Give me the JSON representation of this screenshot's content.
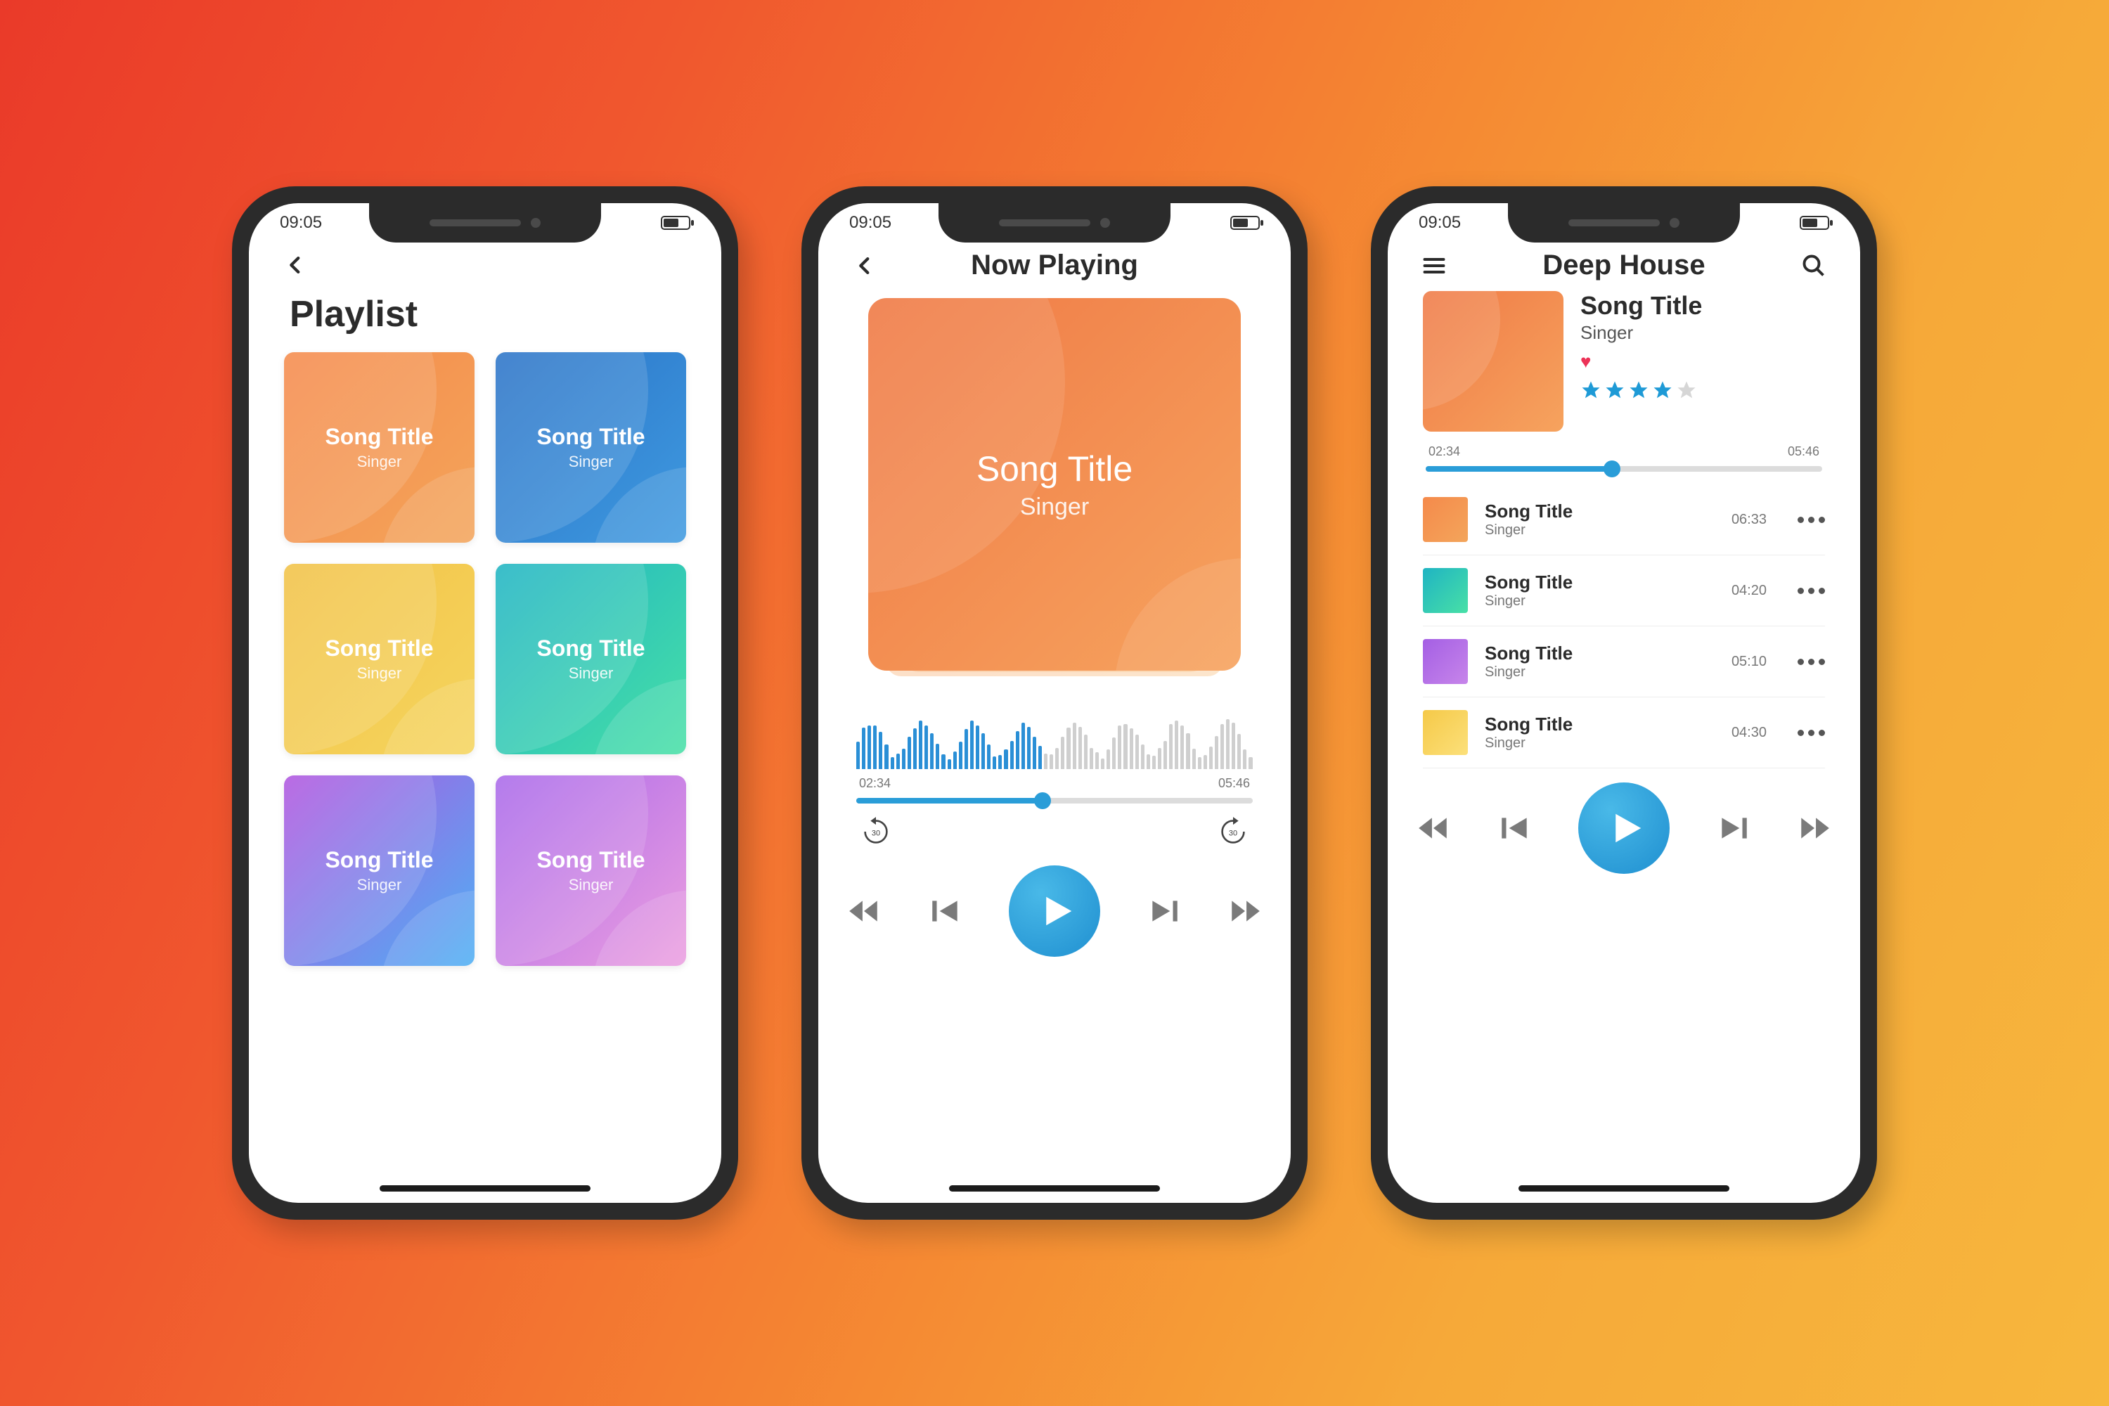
{
  "status_time": "09:05",
  "screen1": {
    "title": "Playlist",
    "cards": [
      {
        "title": "Song Title",
        "subtitle": "Singer",
        "gradient": "g-orange"
      },
      {
        "title": "Song Title",
        "subtitle": "Singer",
        "gradient": "g-blue"
      },
      {
        "title": "Song Title",
        "subtitle": "Singer",
        "gradient": "g-yellow"
      },
      {
        "title": "Song Title",
        "subtitle": "Singer",
        "gradient": "g-teal"
      },
      {
        "title": "Song Title",
        "subtitle": "Singer",
        "gradient": "g-ibg"
      },
      {
        "title": "Song Title",
        "subtitle": "Singer",
        "gradient": "g-pink"
      }
    ]
  },
  "screen2": {
    "title": "Now Playing",
    "album": {
      "title": "Song Title",
      "subtitle": "Singer"
    },
    "time_elapsed": "02:34",
    "time_total": "05:46",
    "progress_pct": 47,
    "seek_back_label": "30",
    "seek_fwd_label": "30"
  },
  "screen3": {
    "title": "Deep House",
    "featured": {
      "title": "Song Title",
      "subtitle": "Singer",
      "rating": 4
    },
    "time_elapsed": "02:34",
    "time_total": "05:46",
    "progress_pct": 47,
    "tracks": [
      {
        "title": "Song Title",
        "subtitle": "Singer",
        "duration": "06:33",
        "gradient": "g-orange"
      },
      {
        "title": "Song Title",
        "subtitle": "Singer",
        "duration": "04:20",
        "gradient": "g-teal"
      },
      {
        "title": "Song Title",
        "subtitle": "Singer",
        "duration": "05:10",
        "gradient": "g-purple"
      },
      {
        "title": "Song Title",
        "subtitle": "Singer",
        "duration": "04:30",
        "gradient": "g-ylw2"
      }
    ]
  }
}
